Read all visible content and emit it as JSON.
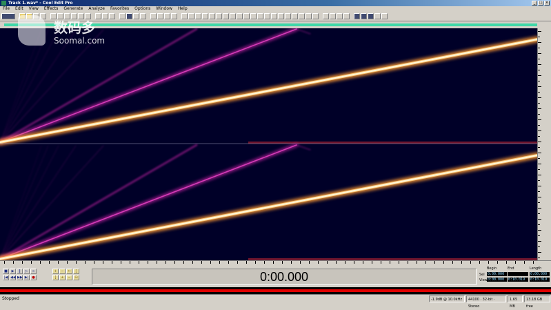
{
  "window": {
    "title": "Track 1.wav* - Cool Edit Pro",
    "controls": [
      "_",
      "□",
      "×"
    ]
  },
  "menu": [
    "File",
    "Edit",
    "View",
    "Effects",
    "Generate",
    "Analyze",
    "Favorites",
    "Options",
    "Window",
    "Help"
  ],
  "watermark": {
    "cn": "数码多",
    "en": "Soomal.com"
  },
  "time_display": "0:00.000",
  "selection_panel": {
    "headers": [
      "Begin",
      "End",
      "Length"
    ],
    "rows": [
      {
        "label": "Sel",
        "values": [
          "0:00.000",
          "",
          "0:00.000"
        ]
      },
      {
        "label": "View",
        "values": [
          "0:00.000",
          "0:10.019",
          "0:10.019"
        ]
      }
    ]
  },
  "status": {
    "left": "Stopped",
    "cells": [
      "-1.9dB @ 10.0kHz",
      "44100 · 32-bit · Stereo",
      "1.65 MB",
      "13.18 GB free"
    ]
  },
  "transport_buttons": [
    "stop",
    "play",
    "pause",
    "play-from-cursor",
    "loop",
    "go-start",
    "rewind",
    "fast-forward",
    "go-end",
    "record"
  ],
  "zoom_buttons": [
    "zoom-in-h",
    "zoom-out-h",
    "zoom-full",
    "zoom-in-left",
    "zoom-in-right",
    "zoom-in-v",
    "zoom-out-v",
    "zoom-sel"
  ],
  "colors": {
    "spectral_bg": "#000028",
    "sweep_core": "#fff6d8",
    "sweep_glow": "#ff9a30",
    "harmonic": "#c020a0",
    "overview": "#3fd8a8"
  }
}
